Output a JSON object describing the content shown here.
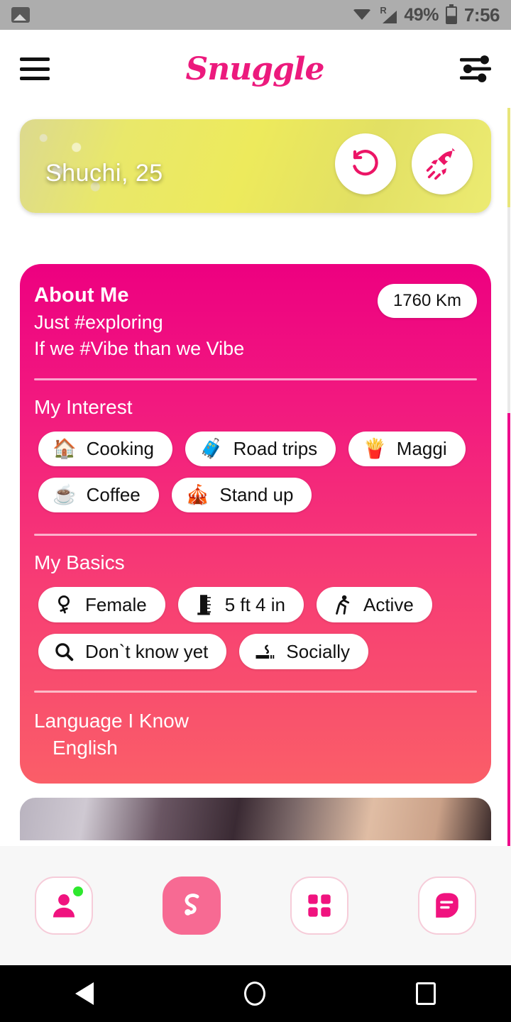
{
  "statusbar": {
    "photo_icon": "photo-icon",
    "wifi_icon": "wifi-icon",
    "signal_icon": "signal-icon",
    "roaming_label": "R",
    "battery_percent": "49%",
    "battery_icon": "battery-icon",
    "time": "7:56"
  },
  "header": {
    "menu_icon": "hamburger-menu-icon",
    "brand": "Snuggle",
    "filter_icon": "filter-sliders-icon"
  },
  "profile_photo_card": {
    "name_age": "Shuchi, 25",
    "undo_icon": "undo-arrow-icon",
    "boost_icon": "rocket-boost-icon"
  },
  "about": {
    "title": "About Me",
    "lines": [
      "Just #exploring",
      "If we #Vibe than we Vibe"
    ],
    "distance_badge": "1760 Km",
    "interests_label": "My Interest",
    "interests": [
      {
        "label": "Cooking",
        "emoji": "🏠",
        "icon": "house-icon"
      },
      {
        "label": "Road trips",
        "emoji": "🧳",
        "icon": "luggage-icon"
      },
      {
        "label": "Maggi",
        "emoji": "🍟",
        "icon": "fast-food-icon"
      },
      {
        "label": "Coffee",
        "emoji": "☕",
        "icon": "coffee-icon"
      },
      {
        "label": "Stand up",
        "emoji": "🎪",
        "icon": "stand-up-icon"
      }
    ],
    "basics_label": "My Basics",
    "basics": [
      {
        "label": "Female",
        "icon": "female-gender-icon"
      },
      {
        "label": "5 ft 4 in",
        "icon": "height-ruler-icon"
      },
      {
        "label": "Active",
        "icon": "exercise-icon"
      },
      {
        "label": "Don`t know yet",
        "icon": "magnifier-icon"
      },
      {
        "label": "Socially",
        "icon": "cigarette-icon"
      }
    ],
    "language_label": "Language I Know",
    "language_value": "English"
  },
  "bottom_nav": [
    {
      "name": "profile",
      "icon": "person-icon",
      "active": false,
      "badge": true
    },
    {
      "name": "discover",
      "icon": "snuggle-s-logo-icon",
      "active": true,
      "badge": false
    },
    {
      "name": "grid",
      "icon": "grid-icon",
      "active": false,
      "badge": false
    },
    {
      "name": "chat",
      "icon": "chat-bubble-icon",
      "active": false,
      "badge": false
    }
  ],
  "android_nav": {
    "back": "back-icon",
    "home": "home-icon",
    "recents": "recents-icon"
  },
  "colors": {
    "brand_pink": "#ec1a7d",
    "card_top": "#ed0080",
    "card_bottom": "#fa5e68",
    "nav_active": "#f76a93",
    "online_dot": "#2ee82e"
  }
}
